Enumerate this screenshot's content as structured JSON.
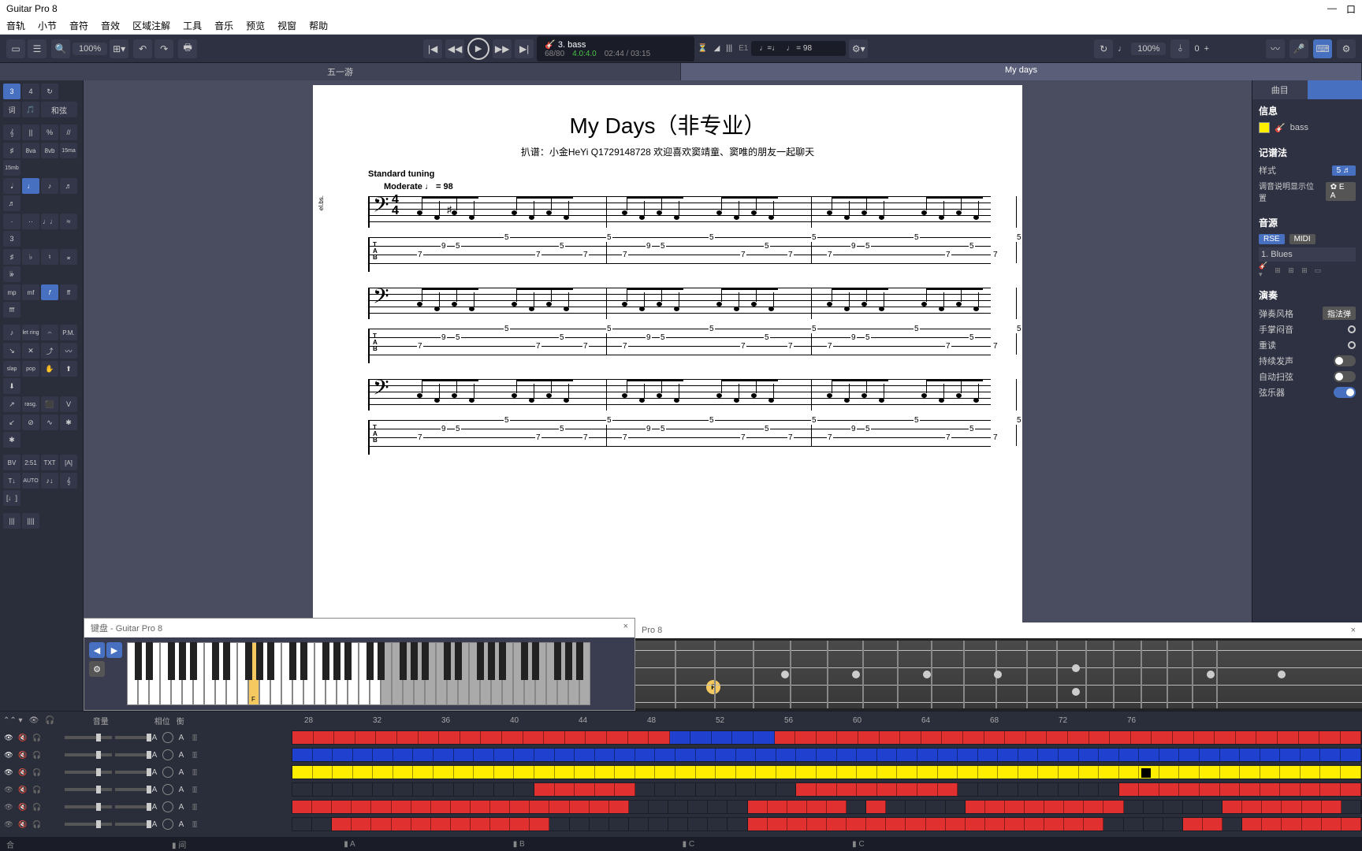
{
  "app": {
    "title": "Guitar Pro 8"
  },
  "menu": [
    "音轨",
    "小节",
    "音符",
    "音效",
    "区域注解",
    "工具",
    "音乐",
    "预览",
    "视窗",
    "帮助"
  ],
  "toolbar": {
    "zoom": "100%",
    "track_no": "3. bass",
    "bars": "68/80",
    "beat": "4.0:4.0",
    "time": "02:44 / 03:15",
    "tempo_sym": "♩=♩",
    "tempo": "♩ = 98",
    "chord": "E1",
    "rt_zoom": "100%",
    "rt_val": "0"
  },
  "tabs": {
    "left": "五一游",
    "right": "My days"
  },
  "palette": {
    "row1": [
      "3",
      "4",
      "↻"
    ],
    "row2": [
      "词",
      "🎵",
      "和弦"
    ],
    "row3": [
      "𝄞",
      "||",
      "%",
      "//"
    ],
    "row4": [
      "♯",
      "8va",
      "8vb",
      "15ma",
      "15mb"
    ],
    "row5": [
      "𝅘𝅥",
      "♩",
      "♪",
      "♬",
      "♬"
    ],
    "row6": [
      "·",
      "··",
      "♩♩",
      "≈",
      "3"
    ],
    "row7": [
      "♯",
      "♭",
      "♮",
      "𝄪",
      "𝄫"
    ],
    "row8": [
      "mp",
      "mf",
      "f",
      "ff",
      "fff"
    ],
    "row9": [
      "♪",
      "let ring",
      "𝄐",
      "P.M."
    ],
    "row10": [
      "↘",
      "✕",
      "⤴",
      "〰"
    ],
    "row11": [
      "slap",
      "pop",
      "✋",
      "⬆",
      "⬇"
    ],
    "row12": [
      "↗",
      "rasg.",
      "⬛",
      "V"
    ],
    "row13": [
      "↙",
      "⊘",
      "∿",
      "✱",
      "✱"
    ],
    "row14": [
      "BV",
      "2:51",
      "TXT",
      "[A]"
    ],
    "row15": [
      "T↓",
      "AUTO",
      "♪↓",
      "𝄞",
      "[♩]"
    ],
    "row16": [
      "|||",
      "||||"
    ]
  },
  "score": {
    "title": "My Days（非专业）",
    "subtitle": "扒谱：小金HeYi Q1729148728 欢迎喜欢窦靖童、窦唯的朋友一起聊天",
    "tuning": "Standard tuning",
    "tempo": "Moderate ♩ = 98",
    "inst": "el.bs.",
    "tab_positions": [
      {
        "s": 3,
        "f": "7"
      },
      {
        "s": 2,
        "f": "9"
      },
      {
        "s": 2,
        "f": "5"
      },
      {
        "s": 1,
        "f": "5"
      },
      {
        "s": 3,
        "f": "7"
      },
      {
        "s": 2,
        "f": "5"
      },
      {
        "s": 3,
        "f": "7"
      },
      {
        "s": 1,
        "f": "5"
      },
      {
        "s": 3,
        "f": "7"
      }
    ]
  },
  "keyboard": {
    "title": "键盘 - Guitar Pro 8",
    "pressed_note": "F"
  },
  "fretboard": {
    "title": "Pro 8",
    "marker": "F"
  },
  "right": {
    "tab1": "曲目",
    "info": "信息",
    "track_name": "bass",
    "notation": "记谱法",
    "style": "样式",
    "style_val": "5 ♬",
    "tuning_label": "调音说明显示位置",
    "tuning_btn": "✿ E A",
    "sound": "音源",
    "rse": "RSE",
    "midi": "MIDI",
    "preset": "1. Blues",
    "perform": "演奏",
    "play_style": "弹奏风格",
    "play_style_val": "指法弹",
    "palm": "手掌闷音",
    "accent": "重读",
    "sustain": "持续发声",
    "auto_brush": "自动扫弦",
    "strings": "弦乐器"
  },
  "tracks": {
    "header_labels": {
      "vol": "音量",
      "pan": "相位",
      "eq": "衡"
    },
    "timeline": [
      "28",
      "32",
      "36",
      "40",
      "44",
      "48",
      "52",
      "56",
      "60",
      "64",
      "68",
      "72",
      "76"
    ],
    "rows": [
      {
        "blocks": "rrrrrrrrrrrrrrrrrrbbbbbrrrrrrrrrrrrrrrrrrrrrrrrrrrr"
      },
      {
        "blocks": "bbbbbbbbbbbbbbbbbbbbbbbbbbbbbbbbbbbbbbbbbbbbbbbbbbbbb"
      },
      {
        "blocks": "yyyyyyyyyyyyyyyyyyyyyyyyyyyyyyyyyyyyyyyyyyyyyyyyyyyyy",
        "marker": 42
      },
      {
        "blocks": "eeeeeeeeeeeerrrrreeeeeeeerrrrrrrreeeeeeeerrrrrrrrrrrr"
      },
      {
        "blocks": "rrrrrrrrrrrrrrrrreeeeeerrrrrereeeerrrrrrrreeeeerrrrrre"
      },
      {
        "blocks": "eerrrrrrrrrrreeeeeeeeeerrrrrrrrrrrrrrrrrreeeerrerrrrrr"
      }
    ],
    "footer": [
      "合",
      "▮ 间",
      "▮ A",
      "▮ B",
      "▮ C",
      "▮ C"
    ]
  }
}
